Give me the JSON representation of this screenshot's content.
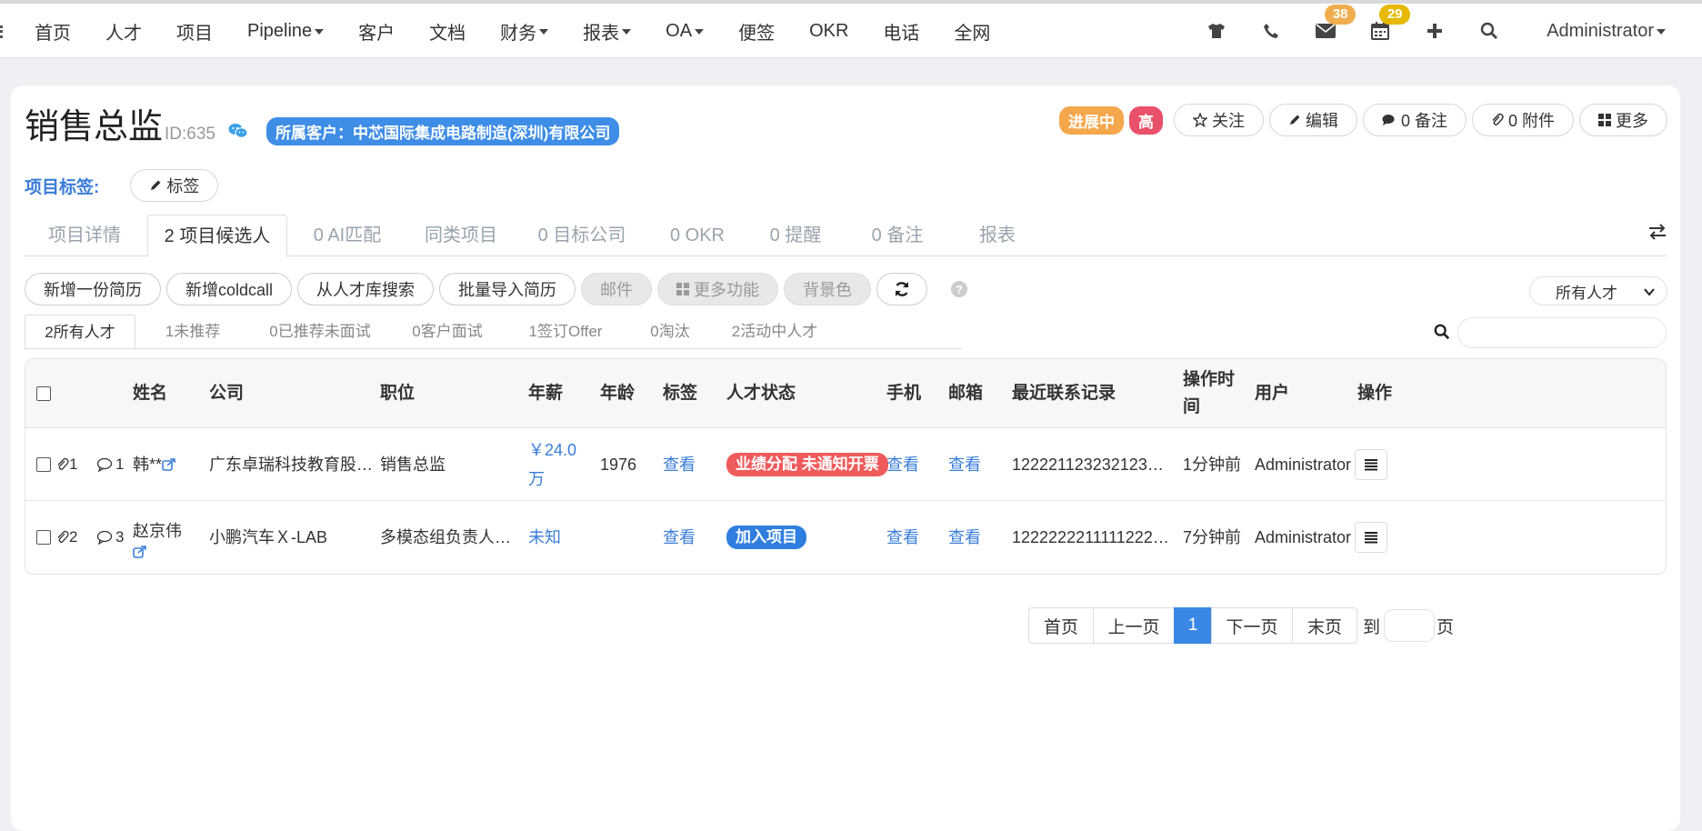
{
  "nav": {
    "items": [
      {
        "label": "首页",
        "caret": false
      },
      {
        "label": "人才",
        "caret": false
      },
      {
        "label": "项目",
        "caret": false
      },
      {
        "label": "Pipeline",
        "caret": true
      },
      {
        "label": "客户",
        "caret": false
      },
      {
        "label": "文档",
        "caret": false
      },
      {
        "label": "财务",
        "caret": true
      },
      {
        "label": "报表",
        "caret": true
      },
      {
        "label": "OA",
        "caret": true
      },
      {
        "label": "便签",
        "caret": false
      },
      {
        "label": "OKR",
        "caret": false
      },
      {
        "label": "电话",
        "caret": false
      },
      {
        "label": "全网",
        "caret": false
      }
    ],
    "mail_count": "38",
    "calendar_count": "29",
    "user": "Administrator"
  },
  "project": {
    "title": "销售总监",
    "id": "ID:635",
    "client": "所属客户：中芯国际集成电路制造(深圳)有限公司",
    "status_tag": "进展中",
    "priority_tag": "高",
    "follow": "关注",
    "edit": "编辑",
    "notes": "0 备注",
    "attachments": "0 附件",
    "more": "更多",
    "labels_title": "项目标签:",
    "labels_btn": "标签"
  },
  "tabs": [
    "项目详情",
    "2 项目候选人",
    "0 AI匹配",
    "同类项目",
    "0 目标公司",
    "0 OKR",
    "0 提醒",
    "0 备注",
    "报表"
  ],
  "toolbar": {
    "add_resume": "新增一份简历",
    "add_coldcall": "新增coldcall",
    "search_pool": "从人才库搜索",
    "batch_import": "批量导入简历",
    "email": "邮件",
    "more_features": "更多功能",
    "bg_color": "背景色",
    "filter": "所有人才"
  },
  "subtabs": [
    "2所有人才",
    "1未推荐",
    "0已推荐未面试",
    "0客户面试",
    "1签订Offer",
    "0淘汰",
    "2活动中人才"
  ],
  "table": {
    "headers": {
      "name": "姓名",
      "company": "公司",
      "position": "职位",
      "salary": "年薪",
      "age": "年龄",
      "tag": "标签",
      "status": "人才状态",
      "phone": "手机",
      "email": "邮箱",
      "contact": "最近联系记录",
      "op_time": "操作时间",
      "user": "用户",
      "ops": "操作"
    },
    "rows": [
      {
        "attach": "1",
        "comments": "1",
        "name": "韩**",
        "company": "广东卓瑞科技教育股…",
        "position": "销售总监",
        "salary": "￥24.0万",
        "age": "1976",
        "tag": "查看",
        "status": "业绩分配 未通知开票",
        "status_color": "#ef5b5b",
        "phone": "查看",
        "email": "查看",
        "contact": "122221123232123…",
        "time": "1分钟前",
        "user": "Administrator"
      },
      {
        "attach": "2",
        "comments": "3",
        "name": "赵京伟",
        "company": "小鹏汽车Ｘ-LAB",
        "position": "多模态组负责人…",
        "salary": "未知",
        "age": "",
        "tag": "查看",
        "status": "加入项目",
        "status_color": "#2f7ee0",
        "phone": "查看",
        "email": "查看",
        "contact": "1222222211111222…",
        "time": "7分钟前",
        "user": "Administrator"
      }
    ]
  },
  "pager": {
    "first": "首页",
    "prev": "上一页",
    "current": "1",
    "next": "下一页",
    "last": "末页",
    "goto": "到",
    "page_unit": "页"
  }
}
